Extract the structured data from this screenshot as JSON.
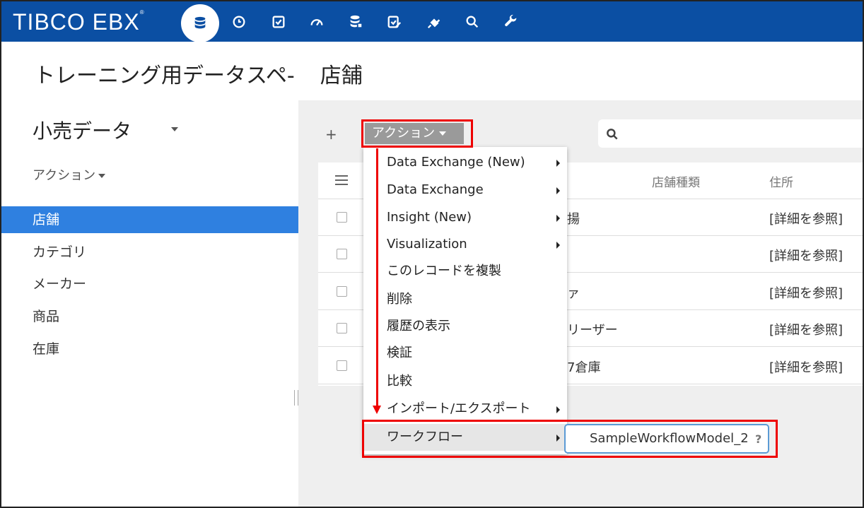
{
  "app": {
    "logo_text": "TIBCO EBX",
    "logo_mark": "®"
  },
  "nav_icons": [
    "database-icon",
    "clock-icon",
    "checkbox-icon",
    "dashboard-icon",
    "data-service-icon",
    "task-edit-icon",
    "plug-icon",
    "search-icon",
    "wrench-icon"
  ],
  "header": {
    "dataspace": "トレーニング用データスペ-",
    "table": "店舗"
  },
  "left": {
    "dataset_title": "小売データ",
    "action_label": "アクション",
    "items": [
      {
        "label": "店舗",
        "selected": true
      },
      {
        "label": "カテゴリ",
        "selected": false
      },
      {
        "label": "メーカー",
        "selected": false
      },
      {
        "label": "商品",
        "selected": false
      },
      {
        "label": "在庫",
        "selected": false
      }
    ]
  },
  "toolbar": {
    "add_label": "+",
    "action_label": "アクション",
    "search_placeholder": ""
  },
  "grid": {
    "columns": [
      "店舗種類",
      "住所"
    ],
    "rows": [
      {
        "name_tail": "揚",
        "address": "[詳細を参照]"
      },
      {
        "name_tail": "",
        "address": "[詳細を参照]"
      },
      {
        "name_tail": "ァ",
        "address": "[詳細を参照]"
      },
      {
        "name_tail": "リーザー",
        "address": "[詳細を参照]"
      },
      {
        "name_tail": "7倉庫",
        "address": "[詳細を参照]"
      }
    ]
  },
  "menu": {
    "items": [
      {
        "label": "Data Exchange (New)",
        "submenu": true
      },
      {
        "label": "Data Exchange",
        "submenu": true
      },
      {
        "label": "Insight (New)",
        "submenu": true
      },
      {
        "label": "Visualization",
        "submenu": true
      },
      {
        "label": "このレコードを複製",
        "submenu": false
      },
      {
        "label": "削除",
        "submenu": false
      },
      {
        "label": "履歴の表示",
        "submenu": false
      },
      {
        "label": "検証",
        "submenu": false
      },
      {
        "label": "比較",
        "submenu": false
      },
      {
        "label": "インポート/エクスポート",
        "submenu": true
      },
      {
        "label": "ワークフロー",
        "submenu": true,
        "highlighted": true
      }
    ],
    "submenu": {
      "label": "SampleWorkflowModel_2",
      "help": "?"
    }
  },
  "colors": {
    "topbar": "#0b4fa3",
    "selected": "#2f80e0",
    "annotation": "#e00000"
  }
}
